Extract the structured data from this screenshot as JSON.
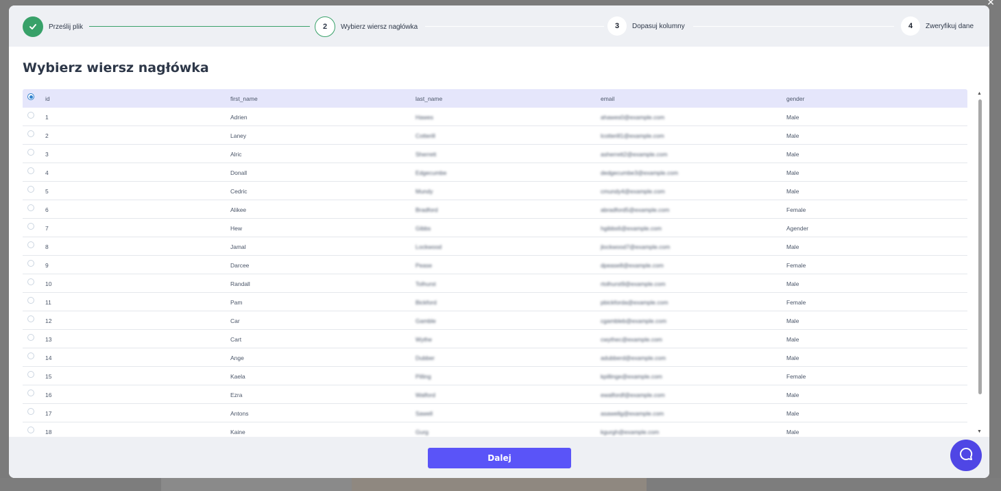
{
  "stepper": {
    "steps": [
      {
        "number": "✓",
        "label": "Prześlij plik",
        "state": "done"
      },
      {
        "number": "2",
        "label": "Wybierz wiersz nagłówka",
        "state": "active"
      },
      {
        "number": "3",
        "label": "Dopasuj kolumny",
        "state": "pending"
      },
      {
        "number": "4",
        "label": "Zweryfikuj dane",
        "state": "pending"
      }
    ]
  },
  "page": {
    "title": "Wybierz wiersz nagłówka"
  },
  "table": {
    "header": {
      "id": "id",
      "first_name": "first_name",
      "last_name": "last_name",
      "email": "email",
      "gender": "gender"
    },
    "rows": [
      {
        "id": "1",
        "first_name": "Adrien",
        "last_name": "Hawes",
        "email": "ahawes0@example.com",
        "gender": "Male"
      },
      {
        "id": "2",
        "first_name": "Laney",
        "last_name": "Cotterill",
        "email": "lcotterill1@example.com",
        "gender": "Male"
      },
      {
        "id": "3",
        "first_name": "Alric",
        "last_name": "Sherrett",
        "email": "asherrett2@example.com",
        "gender": "Male"
      },
      {
        "id": "4",
        "first_name": "Donall",
        "last_name": "Edgecumbe",
        "email": "dedgecumbe3@example.com",
        "gender": "Male"
      },
      {
        "id": "5",
        "first_name": "Cedric",
        "last_name": "Mundy",
        "email": "cmundy4@example.com",
        "gender": "Male"
      },
      {
        "id": "6",
        "first_name": "Alikee",
        "last_name": "Bradford",
        "email": "abradford5@example.com",
        "gender": "Female"
      },
      {
        "id": "7",
        "first_name": "Hew",
        "last_name": "Gibbs",
        "email": "hgibbs6@example.com",
        "gender": "Agender"
      },
      {
        "id": "8",
        "first_name": "Jamal",
        "last_name": "Lockwood",
        "email": "jlockwood7@example.com",
        "gender": "Male"
      },
      {
        "id": "9",
        "first_name": "Darcee",
        "last_name": "Pease",
        "email": "dpease8@example.com",
        "gender": "Female"
      },
      {
        "id": "10",
        "first_name": "Randall",
        "last_name": "Tolhurst",
        "email": "rtolhurst9@example.com",
        "gender": "Male"
      },
      {
        "id": "11",
        "first_name": "Pam",
        "last_name": "Bickford",
        "email": "pbickforda@example.com",
        "gender": "Female"
      },
      {
        "id": "12",
        "first_name": "Car",
        "last_name": "Gamble",
        "email": "cgambleb@example.com",
        "gender": "Male"
      },
      {
        "id": "13",
        "first_name": "Cart",
        "last_name": "Wythe",
        "email": "cwythec@example.com",
        "gender": "Male"
      },
      {
        "id": "14",
        "first_name": "Ange",
        "last_name": "Dubber",
        "email": "adubberd@example.com",
        "gender": "Male"
      },
      {
        "id": "15",
        "first_name": "Kaela",
        "last_name": "Pilling",
        "email": "kpillinge@example.com",
        "gender": "Female"
      },
      {
        "id": "16",
        "first_name": "Ezra",
        "last_name": "Walford",
        "email": "ewalfordf@example.com",
        "gender": "Male"
      },
      {
        "id": "17",
        "first_name": "Antons",
        "last_name": "Sawell",
        "email": "asawellg@example.com",
        "gender": "Male"
      },
      {
        "id": "18",
        "first_name": "Kaine",
        "last_name": "Gurg",
        "email": "kgurgh@example.com",
        "gender": "Male"
      }
    ]
  },
  "footer": {
    "next_label": "Dalej"
  },
  "colors": {
    "accent": "#38a169",
    "primary": "#5a54f8",
    "header_bg": "#e5e6fb",
    "help": "#4f46e5"
  }
}
